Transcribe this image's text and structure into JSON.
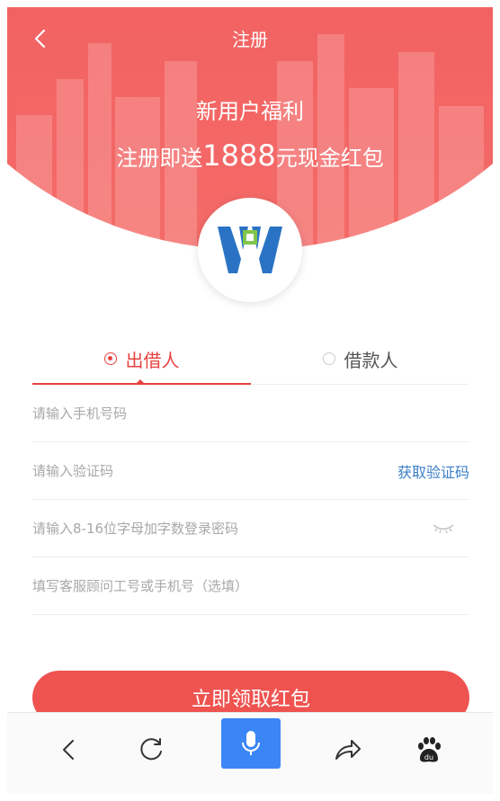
{
  "header": {
    "title": "注册",
    "promo_line1": "新用户福利",
    "promo_line2_prefix": "注册即送",
    "promo_amount": "1888",
    "promo_line2_suffix": "元现金红包"
  },
  "tabs": [
    {
      "label": "出借人",
      "selected": true
    },
    {
      "label": "借款人",
      "selected": false
    }
  ],
  "form": {
    "phone_placeholder": "请输入手机号码",
    "code_placeholder": "请输入验证码",
    "get_code_label": "获取验证码",
    "password_placeholder": "请输入8-16位字母加字数登录密码",
    "advisor_placeholder": "填写客服顾问工号或手机号（选填）",
    "submit_label": "立即领取红包"
  },
  "toolbar": {
    "icons": [
      "back-icon",
      "refresh-icon",
      "microphone-icon",
      "share-icon",
      "baidu-paw-icon"
    ]
  },
  "colors": {
    "brand_red": "#ef5350",
    "link_blue": "#3a7fc8",
    "mic_blue": "#3b86f7",
    "logo_blue": "#2a73c4",
    "logo_green": "#7fc64a"
  }
}
